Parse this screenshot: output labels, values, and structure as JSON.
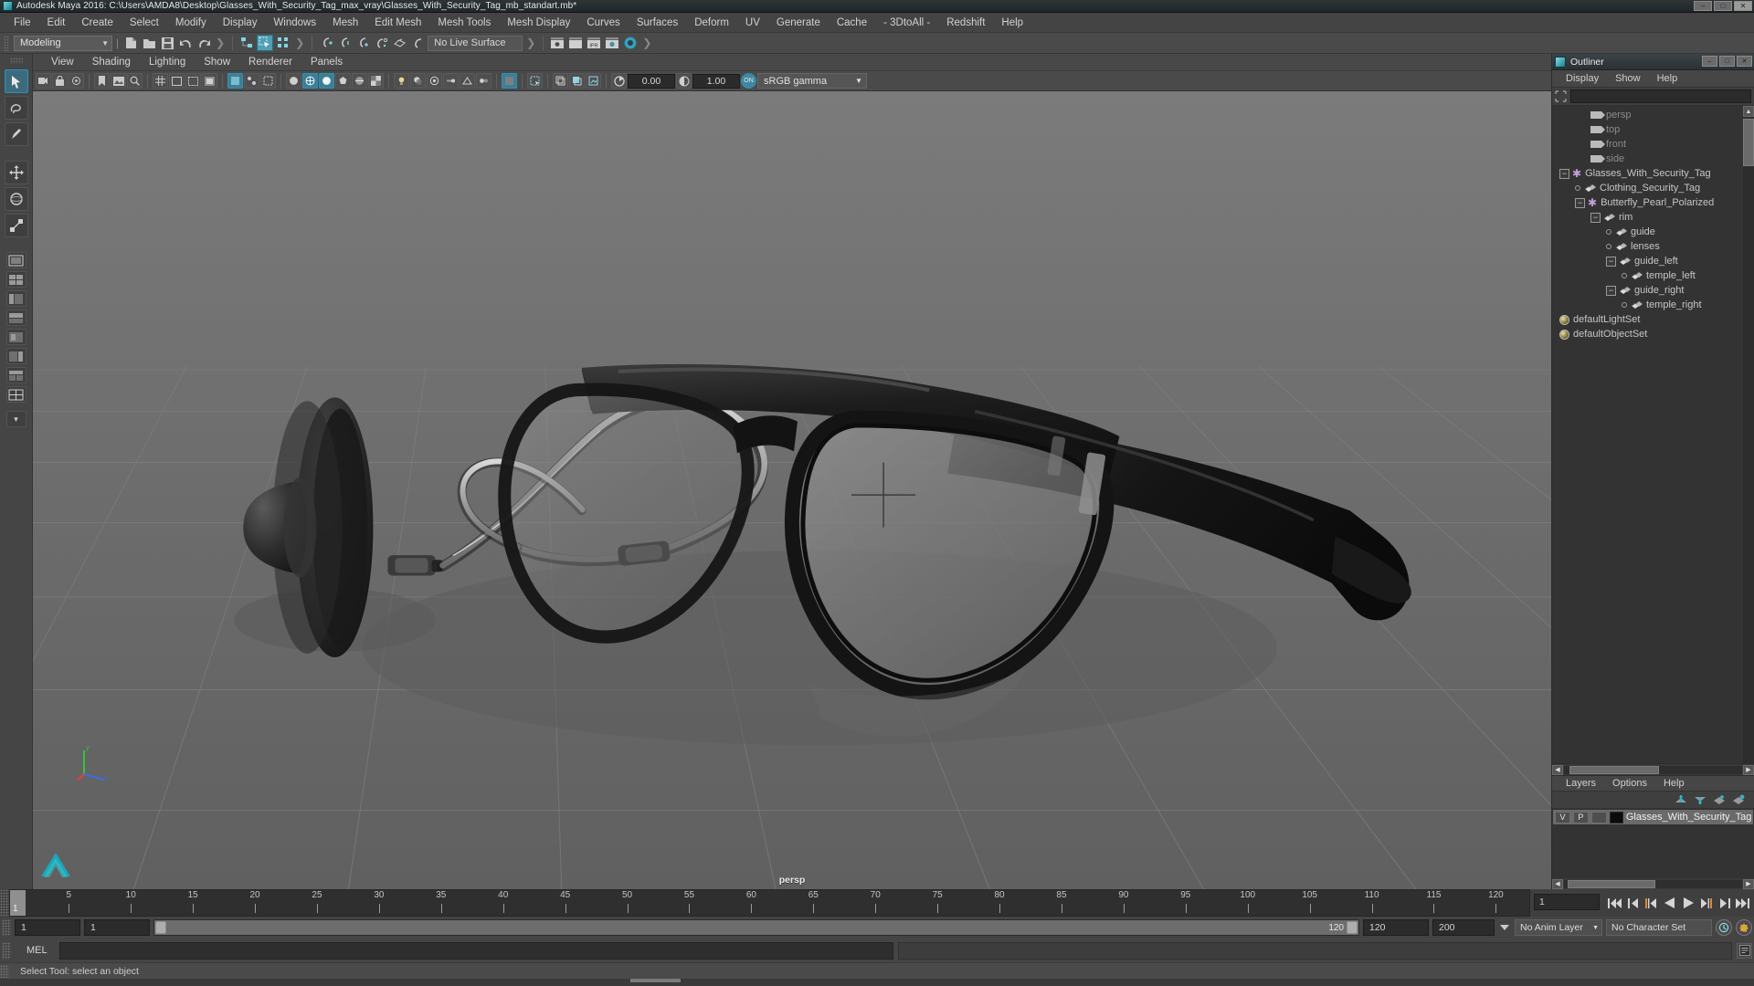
{
  "window": {
    "title": "Autodesk Maya 2016: C:\\Users\\AMDA8\\Desktop\\Glasses_With_Security_Tag_max_vray\\Glasses_With_Security_Tag_mb_standart.mb*",
    "app_icon": "maya-icon",
    "minimize": "–",
    "maximize": "□",
    "close": "✕"
  },
  "menubar": {
    "items": [
      "File",
      "Edit",
      "Create",
      "Select",
      "Modify",
      "Display",
      "Windows",
      "Mesh",
      "Edit Mesh",
      "Mesh Tools",
      "Mesh Display",
      "Curves",
      "Surfaces",
      "Deform",
      "UV",
      "Generate",
      "Cache",
      "- 3DtoAll -",
      "Redshift",
      "Help"
    ]
  },
  "toolbar": {
    "menuset_value": "Modeling",
    "menuset_arrow": "▼",
    "live_surface": "No Live Surface",
    "icons": [
      "new-scene-icon",
      "open-scene-icon",
      "save-scene-icon",
      "undo-icon",
      "redo-icon",
      "select-by-hierarchy-icon",
      "select-by-object-icon",
      "select-by-component-icon",
      "snap-to-grid-icon",
      "snap-to-curve-icon",
      "snap-to-point-icon",
      "snap-to-projected-center-icon",
      "snap-to-view-plane-icon",
      "snap-to-active-object-icon",
      "render-view-icon",
      "render-sequence-icon",
      "ipr-render-icon",
      "render-settings-icon",
      "hypershade-icon"
    ],
    "ipr_label": "IPR"
  },
  "toolbox": {
    "tools": [
      {
        "name": "select-tool",
        "glyph": "➤",
        "active": true
      },
      {
        "name": "lasso-tool",
        "glyph": "✐",
        "active": false
      },
      {
        "name": "paint-select-tool",
        "glyph": "✎",
        "active": false
      },
      {
        "name": "move-tool",
        "glyph": "✚",
        "active": false
      },
      {
        "name": "rotate-tool",
        "glyph": "◈",
        "active": false
      },
      {
        "name": "scale-tool",
        "glyph": "▣",
        "active": false
      }
    ],
    "layout_buttons": [
      "single-perspective-view-icon",
      "four-view-icon",
      "outliner-persp-icon",
      "persp-graph-icon",
      "hypershade-persp-icon",
      "persp-outliner-icon",
      "multi-panel-icon",
      "custom-layout-icon"
    ],
    "more_glyph": "▾"
  },
  "viewport_panel": {
    "menus": [
      "View",
      "Shading",
      "Lighting",
      "Show",
      "Renderer",
      "Panels"
    ],
    "camera_label": "persp",
    "toolbar": {
      "exposure_value": "0.00",
      "gamma_value": "1.00",
      "color_management_on": "ON",
      "color_profile": "sRGB gamma",
      "profile_arrow": "▼",
      "icons": [
        "select-camera-icon",
        "lock-camera-icon",
        "camera-attributes-icon",
        "bookmark-icon",
        "image-plane-icon",
        "two-d-pan-zoom-icon",
        "grid-toggle-icon",
        "film-gate-icon",
        "resolution-gate-icon",
        "gate-mask-icon",
        "xray-icon",
        "xray-joints-icon",
        "xray-active-components-icon",
        "default-shading-icon",
        "wireframe-icon",
        "smooth-shade-icon",
        "flat-shade-icon",
        "shaded-wireframe-icon",
        "textured-icon",
        "use-lights-icon",
        "shadows-icon",
        "ao-icon",
        "motion-blur-icon",
        "multisample-icon",
        "depth-of-field-icon",
        "isolate-select-icon",
        "grid-display-icon",
        "film-gate-display-icon",
        "exposure-icon",
        "contrast-icon"
      ]
    }
  },
  "outliner": {
    "title": "Outliner",
    "window_buttons": {
      "minimize": "–",
      "maximize": "□",
      "close": "✕"
    },
    "menus": [
      "Display",
      "Show",
      "Help"
    ],
    "search_placeholder": "",
    "filter_icon": "filter-icon",
    "tree": [
      {
        "label": "persp",
        "depth": 2,
        "icon": "camera-icon",
        "marker": "none",
        "dim": true
      },
      {
        "label": "top",
        "depth": 2,
        "icon": "camera-icon",
        "marker": "none",
        "dim": true
      },
      {
        "label": "front",
        "depth": 2,
        "icon": "camera-icon",
        "marker": "none",
        "dim": true
      },
      {
        "label": "side",
        "depth": 2,
        "icon": "camera-icon",
        "marker": "none",
        "dim": true
      },
      {
        "label": "Glasses_With_Security_Tag",
        "depth": 0,
        "icon": "transform-icon",
        "marker": "minus",
        "dim": false
      },
      {
        "label": "Clothing_Security_Tag",
        "depth": 1,
        "icon": "mesh-icon",
        "marker": "leaf",
        "dim": false
      },
      {
        "label": "Butterfly_Pearl_Polarized",
        "depth": 1,
        "icon": "transform-icon",
        "marker": "minus",
        "dim": false
      },
      {
        "label": "rim",
        "depth": 2,
        "icon": "mesh-icon",
        "marker": "minus",
        "dim": false
      },
      {
        "label": "guide",
        "depth": 3,
        "icon": "mesh-icon",
        "marker": "leaf",
        "dim": false
      },
      {
        "label": "lenses",
        "depth": 3,
        "icon": "mesh-icon",
        "marker": "leaf",
        "dim": false
      },
      {
        "label": "guide_left",
        "depth": 3,
        "icon": "mesh-icon",
        "marker": "minus",
        "dim": false
      },
      {
        "label": "temple_left",
        "depth": 4,
        "icon": "mesh-icon",
        "marker": "leaf",
        "dim": false
      },
      {
        "label": "guide_right",
        "depth": 3,
        "icon": "mesh-icon",
        "marker": "minus",
        "dim": false
      },
      {
        "label": "temple_right",
        "depth": 4,
        "icon": "mesh-icon",
        "marker": "leaf",
        "dim": false
      },
      {
        "label": "defaultLightSet",
        "depth": 0,
        "icon": "set-icon",
        "marker": "none",
        "dim": false
      },
      {
        "label": "defaultObjectSet",
        "depth": 0,
        "icon": "set-icon",
        "marker": "none",
        "dim": false
      }
    ]
  },
  "layer_editor": {
    "tabs": [
      "Layers",
      "Options",
      "Help"
    ],
    "tool_icons": [
      "move-layer-up-icon",
      "move-layer-down-icon",
      "new-layer-icon",
      "new-layer-from-selected-icon"
    ],
    "layers": [
      {
        "visibility": "V",
        "playback": "P",
        "type": "",
        "color": "#0b0b0b",
        "name": "Glasses_With_Security_Tag"
      }
    ]
  },
  "timeline": {
    "ticks": [
      5,
      10,
      15,
      20,
      25,
      30,
      35,
      40,
      45,
      50,
      55,
      60,
      65,
      70,
      75,
      80,
      85,
      90,
      95,
      100,
      105,
      110,
      115,
      120
    ],
    "start": 1,
    "end": 120,
    "current_frame": "1",
    "current_frame_field": "1",
    "playback_buttons": [
      "go-to-start-icon",
      "step-back-keyframe-icon",
      "step-back-frame-icon",
      "play-backwards-icon",
      "play-forwards-icon",
      "step-forward-frame-icon",
      "step-forward-keyframe-icon",
      "go-to-end-icon"
    ]
  },
  "range_slider": {
    "anim_start": "1",
    "anim_end": "1",
    "range_start": "1",
    "range_end": "120",
    "playback_end": "120",
    "anim_end_total": "200",
    "anim_layer": "No Anim Layer",
    "anim_layer_arrow": "▼",
    "character_set": "No Character Set",
    "auto_key_icon": "auto-keyframe-icon",
    "anim_prefs_icon": "animation-preferences-icon"
  },
  "command_line": {
    "language": "MEL",
    "input_value": "",
    "output_value": "",
    "script_editor_icon": "script-editor-icon"
  },
  "status_bar": {
    "message": "Select Tool: select an object"
  },
  "colors": {
    "accent": "#2a92b8",
    "panel_bg": "#444444",
    "viewport_bg": "#6f6f6f",
    "tree_bg": "#333333",
    "highlight": "#4f9fb5"
  }
}
